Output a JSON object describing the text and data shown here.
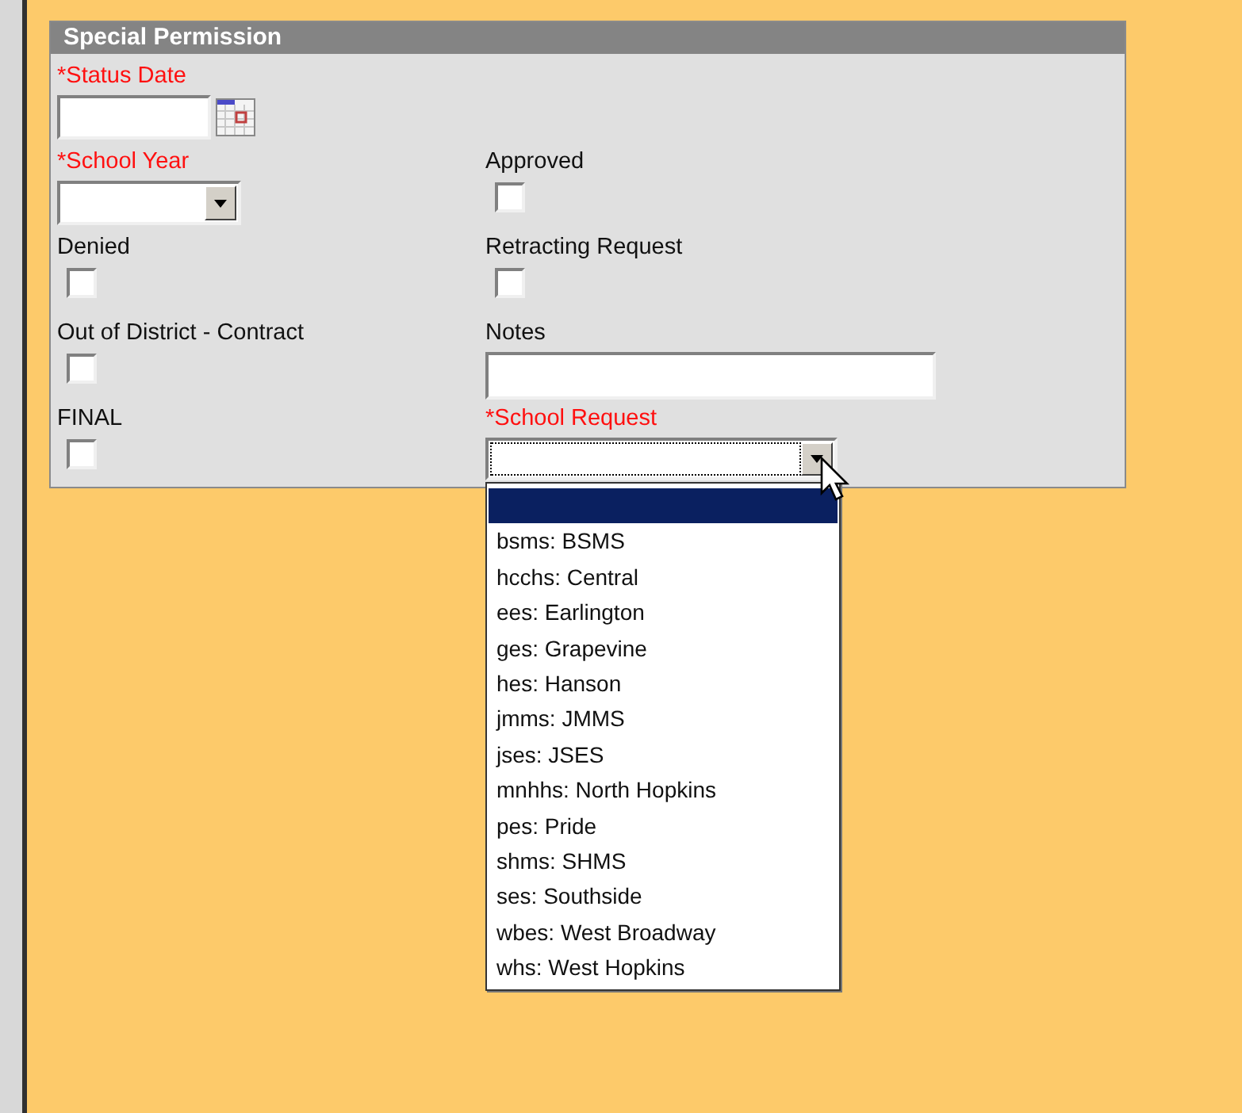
{
  "panel": {
    "title": "Special Permission"
  },
  "rows": [
    [
      {
        "kind": "date",
        "label": "*Status Date",
        "required": true
      }
    ],
    [
      {
        "kind": "select",
        "label": "*School Year",
        "required": true
      },
      {
        "kind": "checkbox",
        "label": "Approved",
        "required": false,
        "checked": false
      }
    ],
    [
      {
        "kind": "checkbox",
        "label": "Denied",
        "required": false,
        "checked": false
      },
      {
        "kind": "checkbox",
        "label": "Retracting Request",
        "required": false,
        "checked": false
      }
    ],
    [
      {
        "kind": "checkbox",
        "label": "Out of District - Contract",
        "required": false,
        "checked": false
      },
      {
        "kind": "text",
        "label": "Notes",
        "required": false
      }
    ],
    [
      {
        "kind": "checkbox",
        "label": "FINAL",
        "required": false,
        "checked": false
      },
      {
        "kind": "select",
        "label": "*School Request",
        "required": true,
        "open": true
      }
    ]
  ],
  "dropdown": {
    "options": [
      {
        "selected": true
      },
      {
        "label": "bsms: BSMS",
        "selected": false
      },
      {
        "label": "hcchs: Central",
        "selected": false
      },
      {
        "label": "ees: Earlington",
        "selected": false
      },
      {
        "label": "ges: Grapevine",
        "selected": false
      },
      {
        "label": "hes: Hanson",
        "selected": false
      },
      {
        "label": "jmms: JMMS",
        "selected": false
      },
      {
        "label": "jses: JSES",
        "selected": false
      },
      {
        "label": "mnhhs: North Hopkins",
        "selected": false
      },
      {
        "label": "pes: Pride",
        "selected": false
      },
      {
        "label": "shms: SHMS",
        "selected": false
      },
      {
        "label": "ses: Southside",
        "selected": false
      },
      {
        "label": "wbes: West Broadway",
        "selected": false
      },
      {
        "label": "whs: West Hopkins",
        "selected": false
      }
    ]
  }
}
